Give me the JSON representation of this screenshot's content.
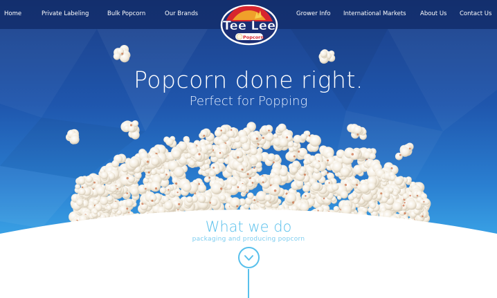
{
  "nav": {
    "left": [
      "Home",
      "Private Labeling",
      "Bulk Popcorn",
      "Our Brands"
    ],
    "right": [
      "Grower Info",
      "International Markets",
      "About Us",
      "Contact Us"
    ]
  },
  "logo": {
    "line1": "Tee Lee",
    "line2": "Popcorn"
  },
  "hero": {
    "title": "Popcorn done right.",
    "subtitle": "Perfect for Popping"
  },
  "section": {
    "title": "What we do",
    "subtitle": "packaging and producing popcorn"
  },
  "colors": {
    "accent": "#58c0ec",
    "hero_top": "#1c3e86",
    "hero_bottom": "#56bdf0",
    "logo_red": "#d8262e",
    "logo_navy": "#1b2e73"
  },
  "icons": {
    "scroll": "chevron-down-icon"
  }
}
